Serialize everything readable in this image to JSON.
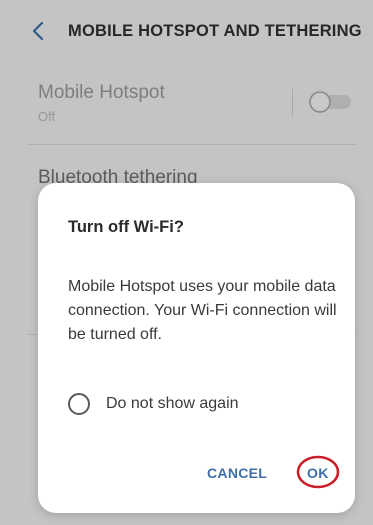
{
  "header": {
    "title": "MOBILE HOTSPOT AND TETHERING",
    "back_icon": "chevron-left-icon"
  },
  "settings": {
    "hotspot": {
      "label": "Mobile Hotspot",
      "status": "Off"
    },
    "bluetooth": {
      "label": "Bluetooth tethering"
    }
  },
  "dialog": {
    "title": "Turn off Wi-Fi?",
    "message": "Mobile Hotspot uses your mobile data connection. Your Wi-Fi connection will be turned off.",
    "checkbox_label": "Do not show again",
    "cancel_label": "CANCEL",
    "ok_label": "OK"
  },
  "colors": {
    "accent": "#3e6fa8",
    "highlight_circle": "#c8202a"
  }
}
